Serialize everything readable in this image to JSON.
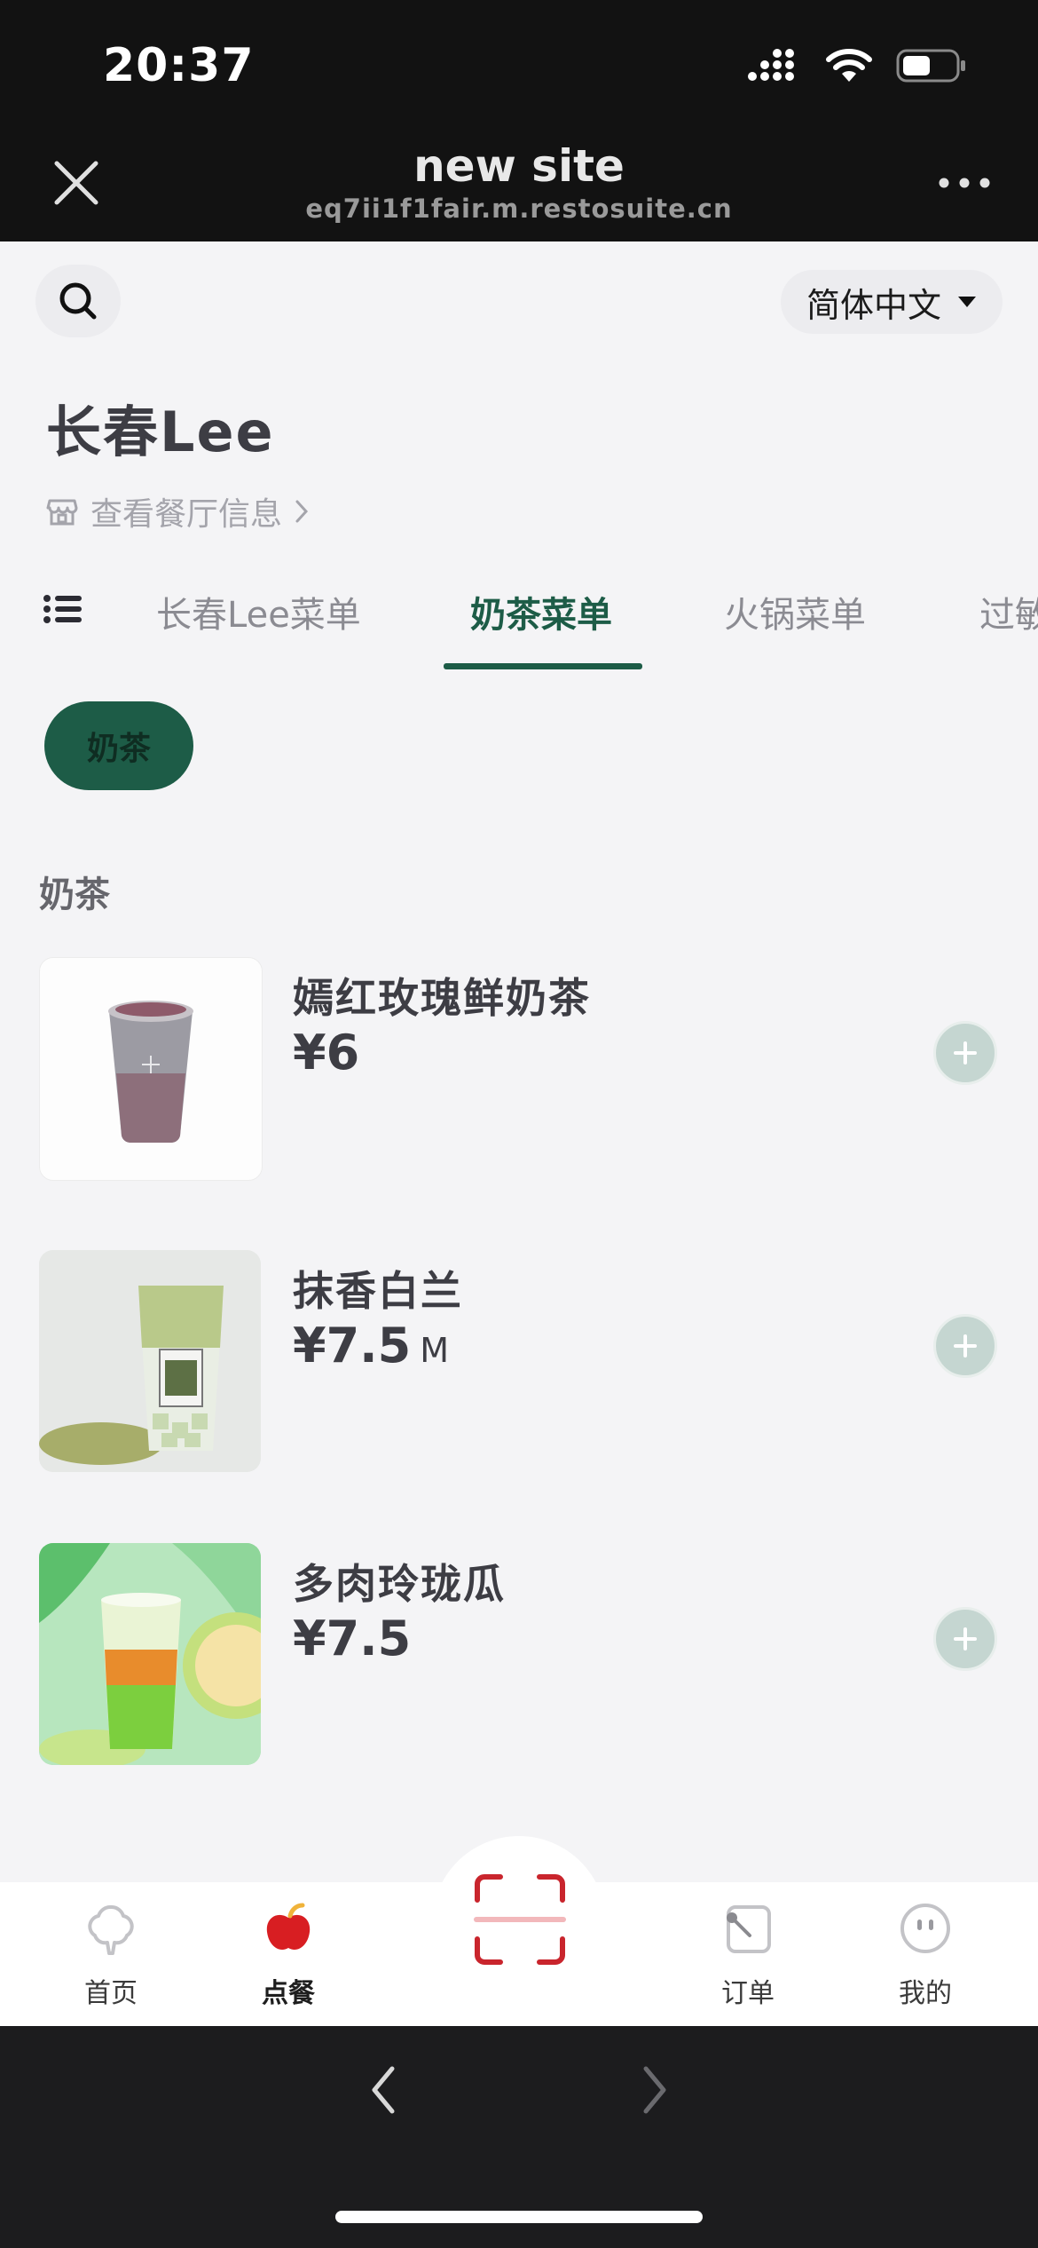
{
  "status_bar": {
    "time": "20:37"
  },
  "webview": {
    "title": "new site",
    "url": "eq7ii1f1fair.m.restosuite.cn"
  },
  "header": {
    "language": "简体中文"
  },
  "restaurant": {
    "name": "长春Lee",
    "info_link": "查看餐厅信息"
  },
  "menu_tabs": [
    {
      "label": "长春Lee菜单",
      "active": false
    },
    {
      "label": "奶茶菜单",
      "active": true
    },
    {
      "label": "火锅菜单",
      "active": false
    },
    {
      "label": "过敏",
      "active": false
    }
  ],
  "category_chip": "奶茶",
  "section_title": "奶茶",
  "items": [
    {
      "name": "嫣红玫瑰鲜奶茶",
      "price": "¥6",
      "spec": ""
    },
    {
      "name": "抹香白兰",
      "price": "¥7.5",
      "spec": "M"
    },
    {
      "name": "多肉玲珑瓜",
      "price": "¥7.5",
      "spec": ""
    }
  ],
  "bottom_nav": {
    "home": "首页",
    "order_food": "点餐",
    "orders": "订单",
    "mine": "我的"
  },
  "colors": {
    "accent": "#1d5c47",
    "scan": "#c9252d",
    "add_button": "#c5d6d1"
  }
}
